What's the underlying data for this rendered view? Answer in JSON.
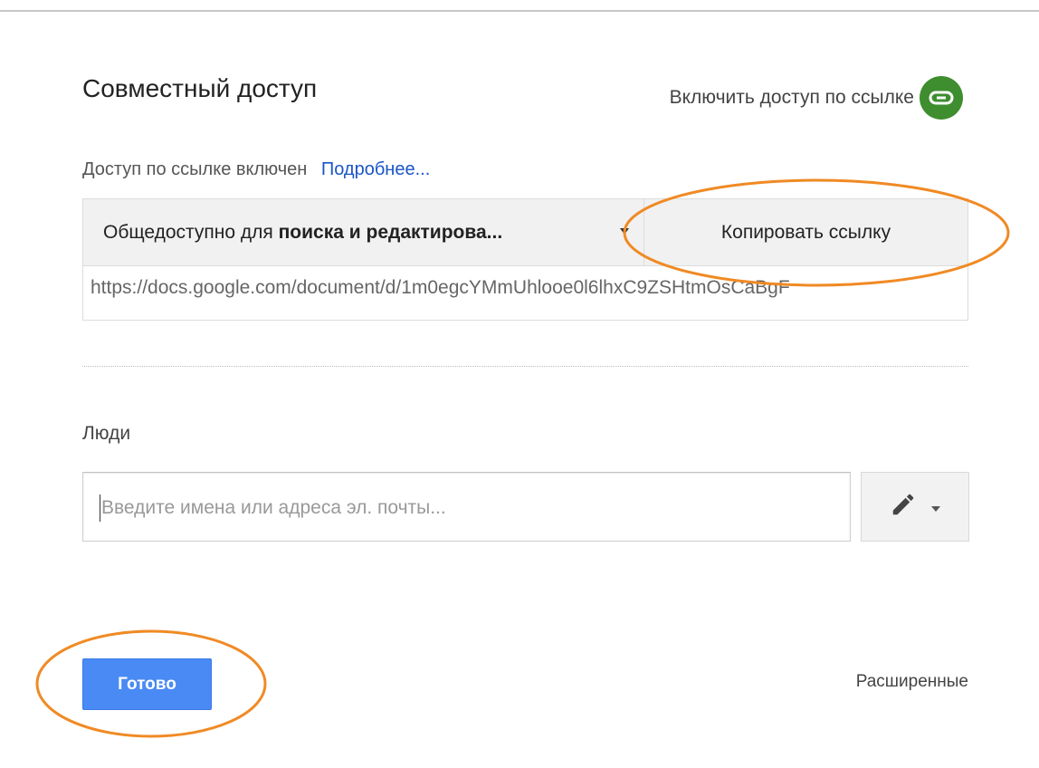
{
  "dialog": {
    "title": "Совместный доступ",
    "link_toggle_label": "Включить доступ по ссылке",
    "link_status": "Доступ по ссылке включен",
    "learn_more": "Подробнее...",
    "access_prefix": "Общедоступно для ",
    "access_bold": "поиска и редактирова...",
    "copy_link": "Копировать ссылку",
    "url": "https://docs.google.com/document/d/1m0egcYMmUhlooe0l6lhxC9ZSHtmOsCaBgF",
    "people_label": "Люди",
    "people_placeholder": "Введите имена или адреса эл. почты...",
    "done": "Готово",
    "advanced": "Расширенные"
  },
  "icons": {
    "link": "link-icon",
    "pencil": "pencil-icon",
    "caret": "chevron-down-icon"
  },
  "colors": {
    "primary_button": "#4a8af4",
    "link_icon_bg": "#3e8e2f",
    "learn_more": "#1a55c7",
    "annotation": "#f08a24"
  }
}
